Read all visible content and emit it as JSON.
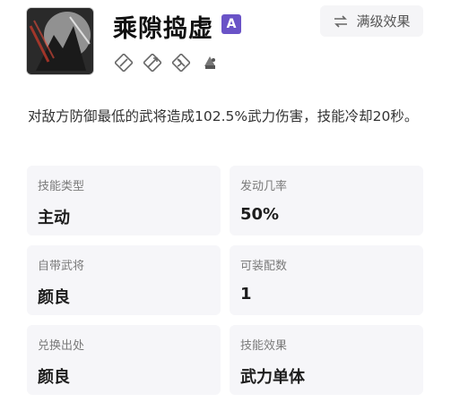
{
  "skill": {
    "name": "乘隙捣虚",
    "grade": "A",
    "unit_icons": [
      "cavalry-icon",
      "spear-icon",
      "archer-icon",
      "siege-icon"
    ],
    "max_effect_label": "满级效果",
    "description": "对敌方防御最低的武将造成102.5%武力伤害，技能冷却20秒。"
  },
  "attributes": [
    {
      "label": "技能类型",
      "value": "主动"
    },
    {
      "label": "发动几率",
      "value": "50%"
    },
    {
      "label": "自带武将",
      "value": "颜良"
    },
    {
      "label": "可装配数",
      "value": "1"
    },
    {
      "label": "兑换出处",
      "value": "颜良"
    },
    {
      "label": "技能效果",
      "value": "武力单体"
    }
  ],
  "colors": {
    "grade_badge": "#6a53c7",
    "cell_bg": "#f6f6f9",
    "button_bg": "#f5f5f7"
  }
}
